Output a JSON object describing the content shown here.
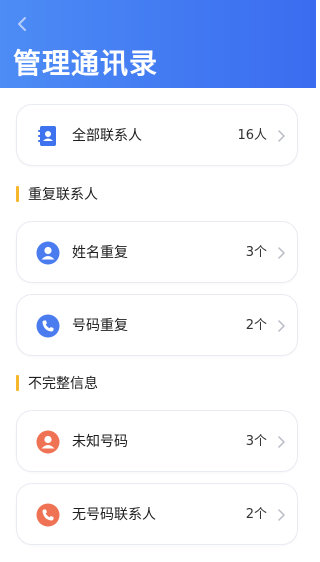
{
  "header": {
    "title": "管理通讯录"
  },
  "all_contacts": {
    "label": "全部联系人",
    "count": "16人",
    "icon": "address-book-icon"
  },
  "sections": [
    {
      "title": "重复联系人",
      "items": [
        {
          "label": "姓名重复",
          "count": "3个",
          "icon": "person-icon",
          "color": "#4a7cf0"
        },
        {
          "label": "号码重复",
          "count": "2个",
          "icon": "phone-icon",
          "color": "#4a7cf0"
        }
      ]
    },
    {
      "title": "不完整信息",
      "items": [
        {
          "label": "未知号码",
          "count": "3个",
          "icon": "person-icon",
          "color": "#f07255"
        },
        {
          "label": "无号码联系人",
          "count": "2个",
          "icon": "phone-icon",
          "color": "#f07255"
        }
      ]
    }
  ],
  "colors": {
    "header_gradient_start": "#4d8cf5",
    "header_gradient_end": "#3a6cf0",
    "section_accent": "#f7b62c",
    "blue_icon": "#4a7cf0",
    "orange_icon": "#f07255"
  }
}
